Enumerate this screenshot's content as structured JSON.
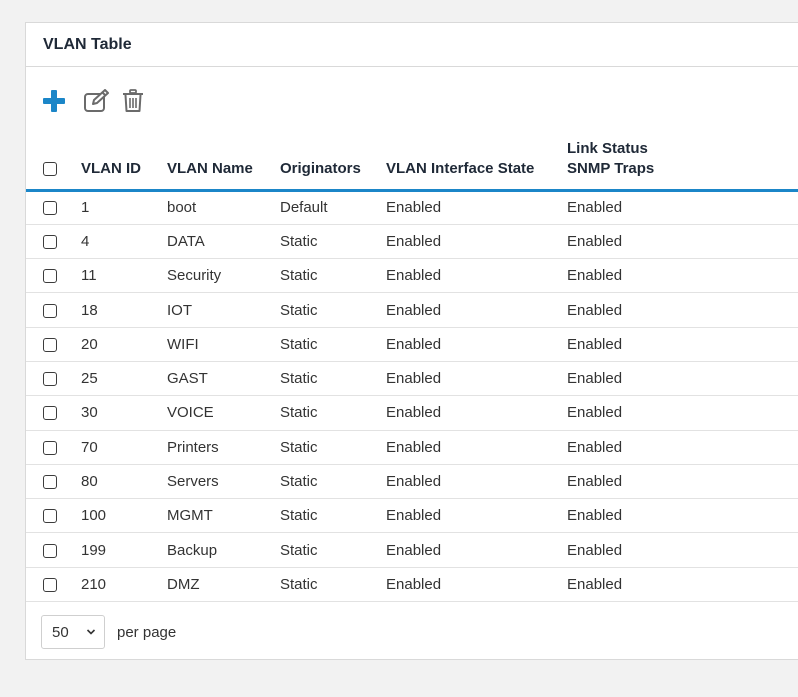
{
  "panel": {
    "title": "VLAN Table"
  },
  "toolbar": {
    "icons": [
      "add-icon",
      "edit-icon",
      "delete-icon"
    ],
    "add_color": "#1b86c8",
    "icon_color": "#6b6b6b"
  },
  "table": {
    "headers": {
      "vlan_id": "VLAN ID",
      "vlan_name": "VLAN Name",
      "originators": "Originators",
      "interface_state": "VLAN Interface State",
      "link_status_line1": "Link Status",
      "link_status_line2": "SNMP Traps"
    },
    "accent_color": "#1b86c8",
    "rows": [
      {
        "id": "1",
        "name": "boot",
        "originator": "Default",
        "state": "Enabled",
        "link": "Enabled"
      },
      {
        "id": "4",
        "name": "DATA",
        "originator": "Static",
        "state": "Enabled",
        "link": "Enabled"
      },
      {
        "id": "11",
        "name": "Security",
        "originator": "Static",
        "state": "Enabled",
        "link": "Enabled"
      },
      {
        "id": "18",
        "name": "IOT",
        "originator": "Static",
        "state": "Enabled",
        "link": "Enabled"
      },
      {
        "id": "20",
        "name": "WIFI",
        "originator": "Static",
        "state": "Enabled",
        "link": "Enabled"
      },
      {
        "id": "25",
        "name": "GAST",
        "originator": "Static",
        "state": "Enabled",
        "link": "Enabled"
      },
      {
        "id": "30",
        "name": "VOICE",
        "originator": "Static",
        "state": "Enabled",
        "link": "Enabled"
      },
      {
        "id": "70",
        "name": "Printers",
        "originator": "Static",
        "state": "Enabled",
        "link": "Enabled"
      },
      {
        "id": "80",
        "name": "Servers",
        "originator": "Static",
        "state": "Enabled",
        "link": "Enabled"
      },
      {
        "id": "100",
        "name": "MGMT",
        "originator": "Static",
        "state": "Enabled",
        "link": "Enabled"
      },
      {
        "id": "199",
        "name": "Backup",
        "originator": "Static",
        "state": "Enabled",
        "link": "Enabled"
      },
      {
        "id": "210",
        "name": "DMZ",
        "originator": "Static",
        "state": "Enabled",
        "link": "Enabled"
      }
    ]
  },
  "pagination": {
    "per_page_value": "50",
    "per_page_label": "per page"
  }
}
